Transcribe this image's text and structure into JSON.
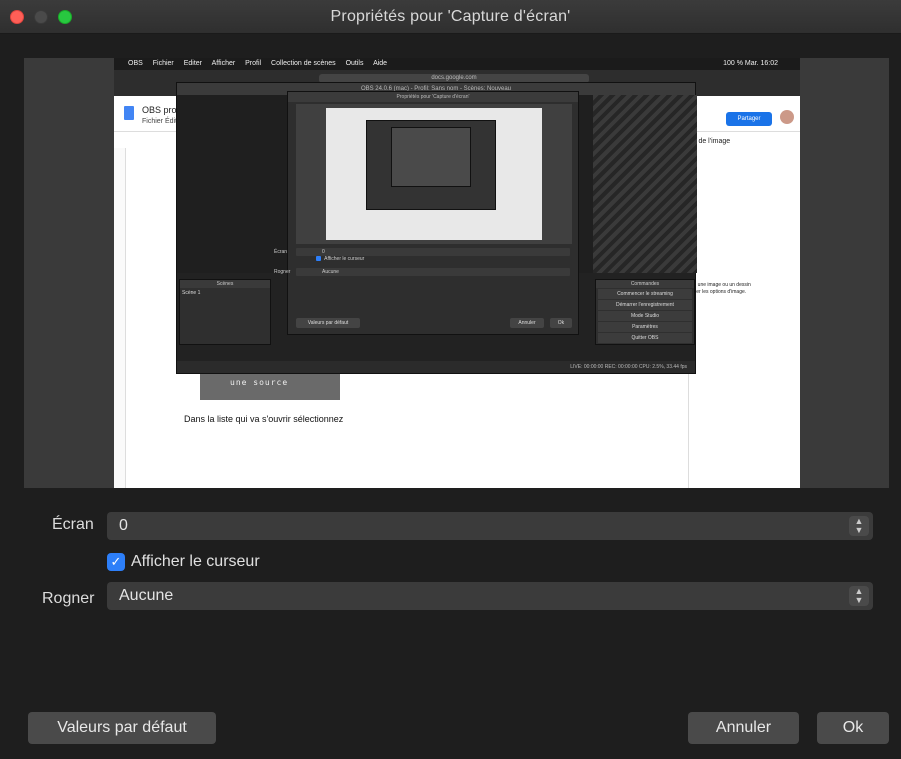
{
  "window": {
    "title": "Propriétés pour 'Capture d'écran'"
  },
  "preview": {
    "mac_menubar": [
      "OBS",
      "Fichier",
      "Editer",
      "Afficher",
      "Profil",
      "Collection de scènes",
      "Outils",
      "Aide"
    ],
    "mac_clock": "100 %  Mar. 16:02",
    "browser_url": "docs.google.com",
    "docs_title": "OBS prod",
    "docs_menu": "Fichier  Édit",
    "docs_share": "Partager",
    "docs_side_title": "s de l'image",
    "docs_side_text": "ez une image ou un dessin cher les options d'image.",
    "doc_body_text": "Dans la liste qui va s'ouvrir sélectionnez",
    "doc_image_text": "une source",
    "obs_title": "OBS 24.0.6 (mac) - Profil: Sans nom - Scènes: Nouveau",
    "obs_scenes_header": "Scènes",
    "obs_scene_item": "Scène 1",
    "obs_commands_header": "Commandes",
    "obs_commands": [
      "Commencer le streaming",
      "Démarrer l'enregistrement",
      "Mode Studio",
      "Paramètres",
      "Quitter OBS"
    ],
    "obs_status": "LIVE: 00:00:00    REC: 00:00:00    CPU: 2.5%, 33.44 fps",
    "inner_dialog_title": "Propriétés pour 'Capture d'écran'",
    "inner_ecran_label": "Écran",
    "inner_ecran_value": "0",
    "inner_cursor_label": "Afficher le curseur",
    "inner_rogner_label": "Rogner",
    "inner_rogner_value": "Aucune",
    "inner_default_btn": "Valeurs par défaut",
    "inner_cancel_btn": "Annuler",
    "inner_ok_btn": "Ok"
  },
  "form": {
    "ecran_label": "Écran",
    "ecran_value": "0",
    "cursor_label": "Afficher le curseur",
    "cursor_checked": true,
    "rogner_label": "Rogner",
    "rogner_value": "Aucune"
  },
  "buttons": {
    "defaults": "Valeurs par défaut",
    "cancel": "Annuler",
    "ok": "Ok"
  }
}
